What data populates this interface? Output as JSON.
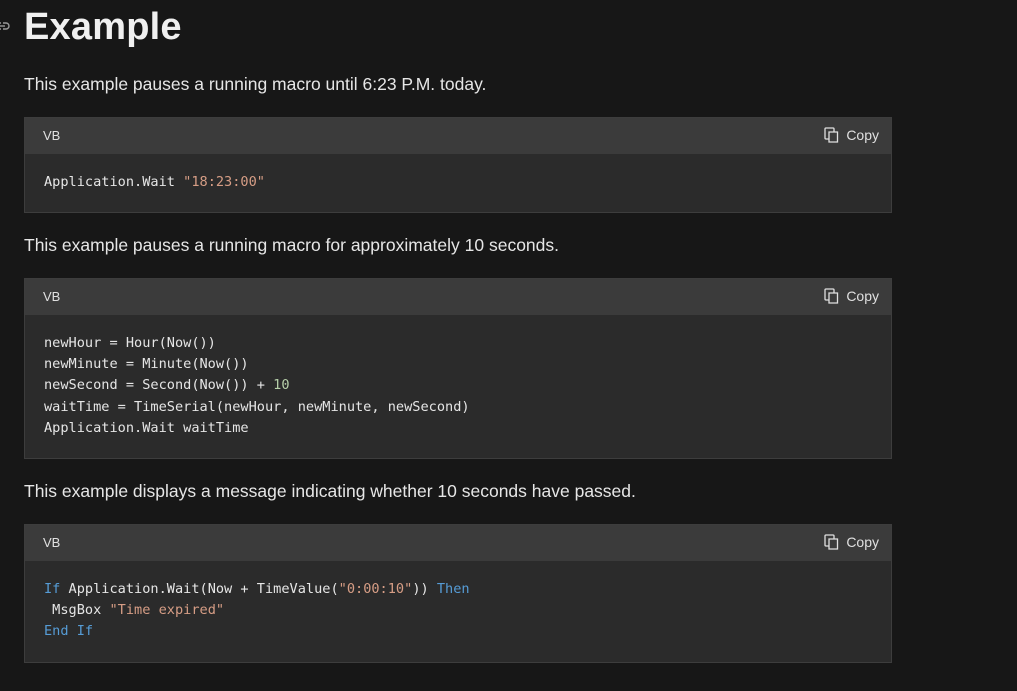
{
  "heading": {
    "title": "Example",
    "anchor_icon": "link-icon"
  },
  "paragraphs": [
    "This example pauses a running macro until 6:23 P.M. today.",
    "This example pauses a running macro for approximately 10 seconds.",
    "This example displays a message indicating whether 10 seconds have passed."
  ],
  "copy_icon": "copy-icon",
  "colors": {
    "page_background": "#171717",
    "code_background": "#2b2b2b",
    "code_header_background": "#3b3b3b",
    "string": "#d69d85",
    "number": "#b5cea8",
    "keyword": "#569cd6"
  },
  "code_blocks": [
    {
      "language": "VB",
      "copy_label": "Copy",
      "lines": [
        [
          {
            "text": "Application.Wait "
          },
          {
            "text": "\"18:23:00\"",
            "kind": "string"
          }
        ]
      ]
    },
    {
      "language": "VB",
      "copy_label": "Copy",
      "lines": [
        [
          {
            "text": "newHour = Hour(Now())"
          }
        ],
        [
          {
            "text": "newMinute = Minute(Now())"
          }
        ],
        [
          {
            "text": "newSecond = Second(Now()) + "
          },
          {
            "text": "10",
            "kind": "number"
          }
        ],
        [
          {
            "text": "waitTime = TimeSerial(newHour, newMinute, newSecond)"
          }
        ],
        [
          {
            "text": "Application.Wait waitTime"
          }
        ]
      ]
    },
    {
      "language": "VB",
      "copy_label": "Copy",
      "lines": [
        [
          {
            "text": "If",
            "kind": "keyword"
          },
          {
            "text": " Application.Wait(Now + TimeValue("
          },
          {
            "text": "\"0:00:10\"",
            "kind": "string"
          },
          {
            "text": ")) "
          },
          {
            "text": "Then",
            "kind": "keyword"
          }
        ],
        [
          {
            "text": " MsgBox "
          },
          {
            "text": "\"Time expired\"",
            "kind": "string"
          }
        ],
        [
          {
            "text": "End",
            "kind": "keyword"
          },
          {
            "text": " "
          },
          {
            "text": "If",
            "kind": "keyword"
          }
        ]
      ]
    }
  ]
}
